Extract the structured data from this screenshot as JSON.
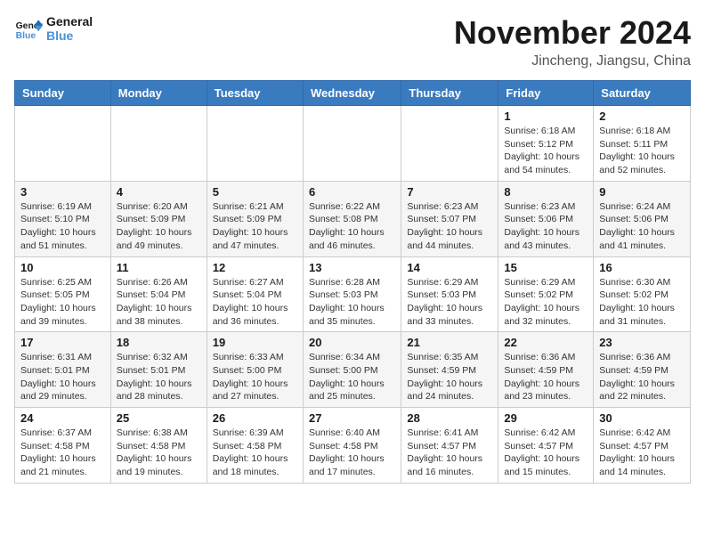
{
  "logo": {
    "line1": "General",
    "line2": "Blue"
  },
  "title": "November 2024",
  "location": "Jincheng, Jiangsu, China",
  "weekdays": [
    "Sunday",
    "Monday",
    "Tuesday",
    "Wednesday",
    "Thursday",
    "Friday",
    "Saturday"
  ],
  "weeks": [
    [
      {
        "day": "",
        "info": ""
      },
      {
        "day": "",
        "info": ""
      },
      {
        "day": "",
        "info": ""
      },
      {
        "day": "",
        "info": ""
      },
      {
        "day": "",
        "info": ""
      },
      {
        "day": "1",
        "info": "Sunrise: 6:18 AM\nSunset: 5:12 PM\nDaylight: 10 hours\nand 54 minutes."
      },
      {
        "day": "2",
        "info": "Sunrise: 6:18 AM\nSunset: 5:11 PM\nDaylight: 10 hours\nand 52 minutes."
      }
    ],
    [
      {
        "day": "3",
        "info": "Sunrise: 6:19 AM\nSunset: 5:10 PM\nDaylight: 10 hours\nand 51 minutes."
      },
      {
        "day": "4",
        "info": "Sunrise: 6:20 AM\nSunset: 5:09 PM\nDaylight: 10 hours\nand 49 minutes."
      },
      {
        "day": "5",
        "info": "Sunrise: 6:21 AM\nSunset: 5:09 PM\nDaylight: 10 hours\nand 47 minutes."
      },
      {
        "day": "6",
        "info": "Sunrise: 6:22 AM\nSunset: 5:08 PM\nDaylight: 10 hours\nand 46 minutes."
      },
      {
        "day": "7",
        "info": "Sunrise: 6:23 AM\nSunset: 5:07 PM\nDaylight: 10 hours\nand 44 minutes."
      },
      {
        "day": "8",
        "info": "Sunrise: 6:23 AM\nSunset: 5:06 PM\nDaylight: 10 hours\nand 43 minutes."
      },
      {
        "day": "9",
        "info": "Sunrise: 6:24 AM\nSunset: 5:06 PM\nDaylight: 10 hours\nand 41 minutes."
      }
    ],
    [
      {
        "day": "10",
        "info": "Sunrise: 6:25 AM\nSunset: 5:05 PM\nDaylight: 10 hours\nand 39 minutes."
      },
      {
        "day": "11",
        "info": "Sunrise: 6:26 AM\nSunset: 5:04 PM\nDaylight: 10 hours\nand 38 minutes."
      },
      {
        "day": "12",
        "info": "Sunrise: 6:27 AM\nSunset: 5:04 PM\nDaylight: 10 hours\nand 36 minutes."
      },
      {
        "day": "13",
        "info": "Sunrise: 6:28 AM\nSunset: 5:03 PM\nDaylight: 10 hours\nand 35 minutes."
      },
      {
        "day": "14",
        "info": "Sunrise: 6:29 AM\nSunset: 5:03 PM\nDaylight: 10 hours\nand 33 minutes."
      },
      {
        "day": "15",
        "info": "Sunrise: 6:29 AM\nSunset: 5:02 PM\nDaylight: 10 hours\nand 32 minutes."
      },
      {
        "day": "16",
        "info": "Sunrise: 6:30 AM\nSunset: 5:02 PM\nDaylight: 10 hours\nand 31 minutes."
      }
    ],
    [
      {
        "day": "17",
        "info": "Sunrise: 6:31 AM\nSunset: 5:01 PM\nDaylight: 10 hours\nand 29 minutes."
      },
      {
        "day": "18",
        "info": "Sunrise: 6:32 AM\nSunset: 5:01 PM\nDaylight: 10 hours\nand 28 minutes."
      },
      {
        "day": "19",
        "info": "Sunrise: 6:33 AM\nSunset: 5:00 PM\nDaylight: 10 hours\nand 27 minutes."
      },
      {
        "day": "20",
        "info": "Sunrise: 6:34 AM\nSunset: 5:00 PM\nDaylight: 10 hours\nand 25 minutes."
      },
      {
        "day": "21",
        "info": "Sunrise: 6:35 AM\nSunset: 4:59 PM\nDaylight: 10 hours\nand 24 minutes."
      },
      {
        "day": "22",
        "info": "Sunrise: 6:36 AM\nSunset: 4:59 PM\nDaylight: 10 hours\nand 23 minutes."
      },
      {
        "day": "23",
        "info": "Sunrise: 6:36 AM\nSunset: 4:59 PM\nDaylight: 10 hours\nand 22 minutes."
      }
    ],
    [
      {
        "day": "24",
        "info": "Sunrise: 6:37 AM\nSunset: 4:58 PM\nDaylight: 10 hours\nand 21 minutes."
      },
      {
        "day": "25",
        "info": "Sunrise: 6:38 AM\nSunset: 4:58 PM\nDaylight: 10 hours\nand 19 minutes."
      },
      {
        "day": "26",
        "info": "Sunrise: 6:39 AM\nSunset: 4:58 PM\nDaylight: 10 hours\nand 18 minutes."
      },
      {
        "day": "27",
        "info": "Sunrise: 6:40 AM\nSunset: 4:58 PM\nDaylight: 10 hours\nand 17 minutes."
      },
      {
        "day": "28",
        "info": "Sunrise: 6:41 AM\nSunset: 4:57 PM\nDaylight: 10 hours\nand 16 minutes."
      },
      {
        "day": "29",
        "info": "Sunrise: 6:42 AM\nSunset: 4:57 PM\nDaylight: 10 hours\nand 15 minutes."
      },
      {
        "day": "30",
        "info": "Sunrise: 6:42 AM\nSunset: 4:57 PM\nDaylight: 10 hours\nand 14 minutes."
      }
    ]
  ]
}
